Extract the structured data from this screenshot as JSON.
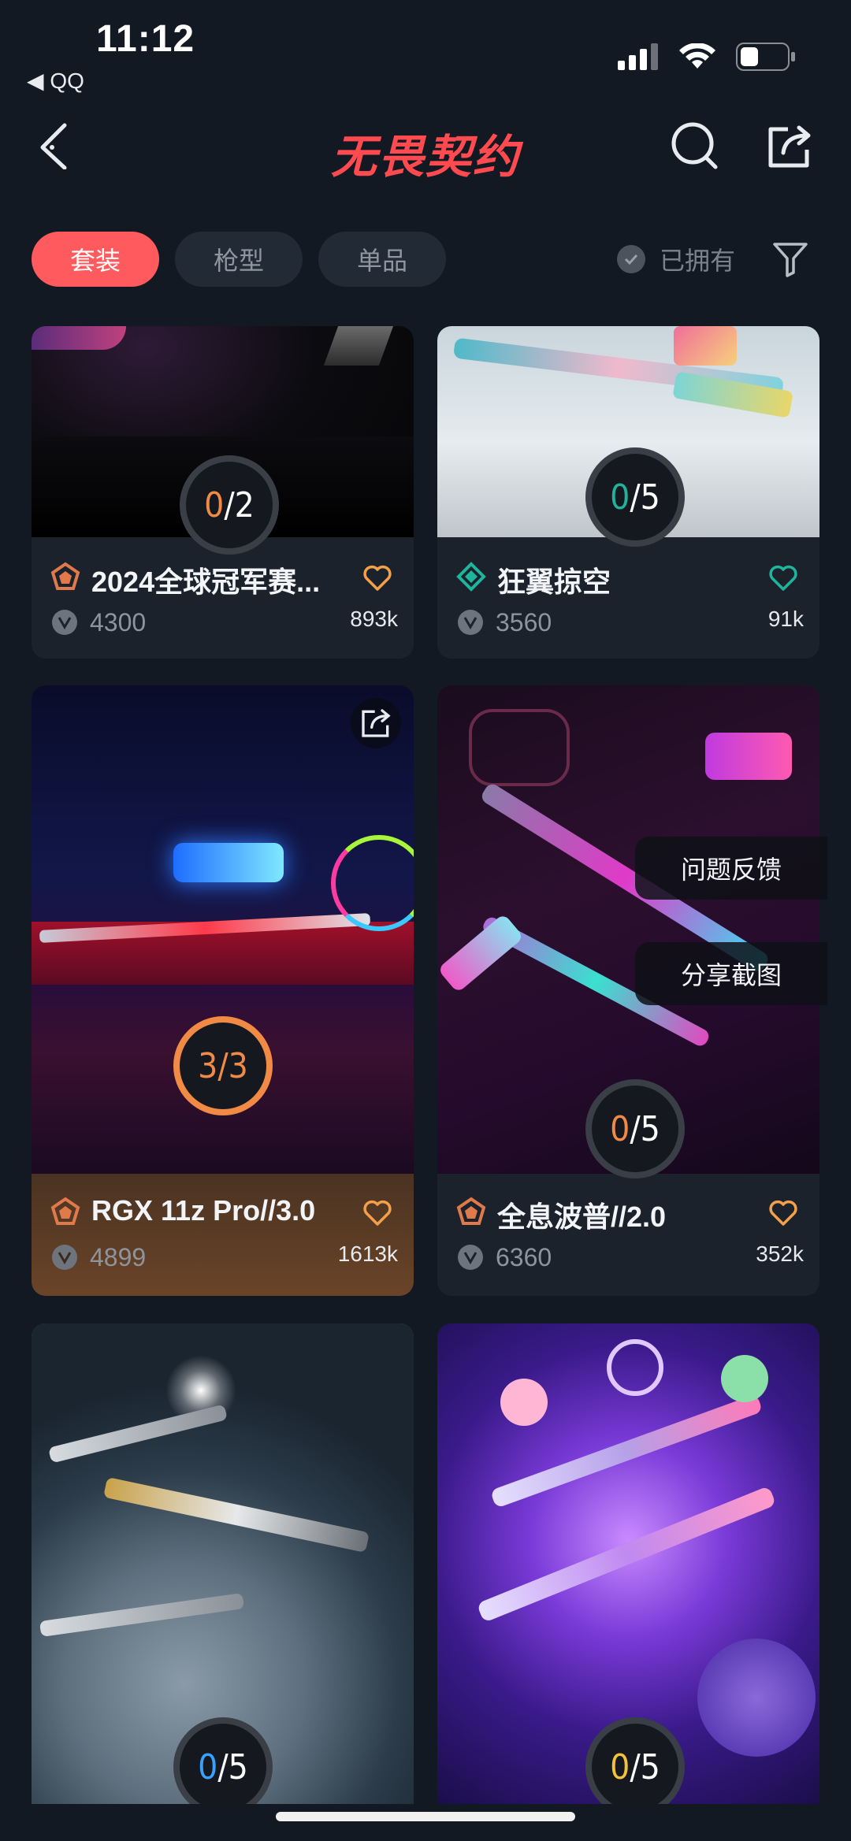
{
  "status": {
    "time": "11:12",
    "back_app": "◀ QQ"
  },
  "header": {
    "title": "无畏契约"
  },
  "tabs": [
    {
      "label": "套装",
      "active": true
    },
    {
      "label": "枪型",
      "active": false
    },
    {
      "label": "单品",
      "active": false
    }
  ],
  "owned_filter": {
    "label": "已拥有"
  },
  "cards": [
    {
      "title": "2024全球冠军赛...",
      "price": "4300",
      "likes": "893k",
      "owned": "0",
      "total": "/2",
      "owned_color": "#f08a45",
      "rarity_color": "#e07a4a"
    },
    {
      "title": "狂翼掠空",
      "price": "3560",
      "likes": "91k",
      "owned": "0",
      "total": "/5",
      "owned_color": "#20b29a",
      "rarity_color": "#1fb59c"
    },
    {
      "title": "RGX 11z Pro//3.0",
      "price": "4899",
      "likes": "1613k",
      "owned": "3",
      "total": "/3",
      "owned_color": "#f08a45",
      "rarity_color": "#e07a4a"
    },
    {
      "title": "全息波普//2.0",
      "price": "6360",
      "likes": "352k",
      "owned": "0",
      "total": "/5",
      "owned_color": "#f08a45",
      "rarity_color": "#e07a4a"
    },
    {
      "owned": "0",
      "total": "/5",
      "owned_color": "#3aa0ff"
    },
    {
      "owned": "0",
      "total": "/5",
      "owned_color": "#f2c23a"
    }
  ],
  "floating_menu": {
    "feedback": "问题反馈",
    "share_screenshot": "分享截图"
  },
  "colors": {
    "accent": "#ff5a5d",
    "background": "#131922",
    "card": "#1b222c"
  }
}
